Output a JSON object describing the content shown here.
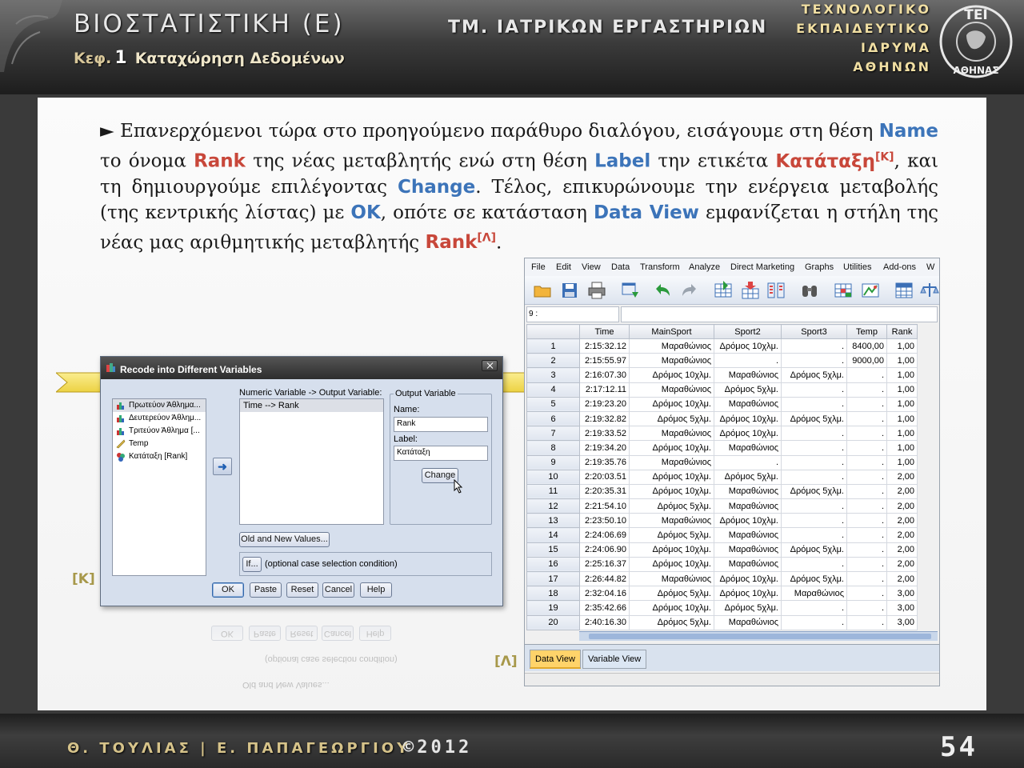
{
  "header": {
    "course_title": "ΒΙΟΣΤΑΤΙΣΤΙΚΗ (Ε)",
    "chapter_prefix": "Κεφ.",
    "chapter_number": "1",
    "chapter_title": "Καταχώρηση Δεδομένων",
    "department": "ΤΜ. ΙΑΤΡΙΚΩΝ ΕΡΓΑΣΤΗΡΙΩΝ",
    "institution_lines": [
      "ΤΕΧΝΟΛΟΓΙΚΟ",
      "ΕΚΠΑΙΔΕΥΤΙΚΟ",
      "ΙΔΡΥΜΑ",
      "ΑΘΗΝΩΝ"
    ],
    "logo_text": "ΤΕΙ ΑΘΗΝΑΣ"
  },
  "paragraph": {
    "bullet": "►",
    "t1": " Επανερχόμενοι τώρα στο προηγούμενο παράθυρο διαλόγου, εισάγουμε στη θέση ",
    "k1": "Name",
    "t2": " το όνομα ",
    "k2": "Rank",
    "t3": " της νέας μεταβλητής ενώ στη θέση ",
    "k3": "Label",
    "t4": " την ετικέτα ",
    "k4": "Κατάταξη",
    "ref_k": "[Κ]",
    "t5": ", και τη δημιουργούμε επιλέγοντας ",
    "k5": "Change",
    "t6": ". Τέλος, επικυρώνουμε την ενέργεια μεταβολής (της κεντρικής λίστας) με ",
    "k6": "OK",
    "t7": ", οπότε σε κατάσταση ",
    "k7": "Data View",
    "t8": " εμφανίζεται η στήλη της νέας μας αριθμητικής μεταβλητής ",
    "k8": "Rank",
    "ref_l": "[Λ]",
    "t9": "."
  },
  "dialog": {
    "title": "Recode into Different Variables",
    "variables": [
      "Πρωτεύον Άθλημα...",
      "Δευτερεύον Άθλημ...",
      "Τριτεύον Άθλημα [...",
      "Temp",
      "Κατάταξη [Rank]"
    ],
    "mapping_label": "Numeric Variable -> Output Variable:",
    "mapping_row": "Time --> Rank",
    "output_group": "Output Variable",
    "name_label": "Name:",
    "name_value": "Rank",
    "label_label": "Label:",
    "label_value": "Κατάταξη",
    "change": "Change",
    "old_new": "Old and New Values...",
    "if": "If...",
    "if_hint": "(optional case selection condition)",
    "ok": "OK",
    "paste": "Paste",
    "reset": "Reset",
    "cancel": "Cancel",
    "help": "Help"
  },
  "tags": {
    "k": "[Κ]",
    "l": "[Λ]"
  },
  "data_view": {
    "menu": [
      "File",
      "Edit",
      "View",
      "Data",
      "Transform",
      "Analyze",
      "Direct Marketing",
      "Graphs",
      "Utilities",
      "Add-ons",
      "W"
    ],
    "cell_ref": "9 :",
    "columns": [
      "",
      "Time",
      "MainSport",
      "Sport2",
      "Sport3",
      "Temp",
      "Rank"
    ],
    "rows": [
      [
        "1",
        "2:15:32.12",
        "Μαραθώνιος",
        "Δρόμος 10χλμ.",
        ".",
        "8400,00",
        "1,00"
      ],
      [
        "2",
        "2:15:55.97",
        "Μαραθώνιος",
        ".",
        ".",
        "9000,00",
        "1,00"
      ],
      [
        "3",
        "2:16:07.30",
        "Δρόμος 10χλμ.",
        "Μαραθώνιος",
        "Δρόμος 5χλμ.",
        ".",
        "1,00"
      ],
      [
        "4",
        "2:17:12.11",
        "Μαραθώνιος",
        "Δρόμος 5χλμ.",
        ".",
        ".",
        "1,00"
      ],
      [
        "5",
        "2:19:23.20",
        "Δρόμος 10χλμ.",
        "Μαραθώνιος",
        ".",
        ".",
        "1,00"
      ],
      [
        "6",
        "2:19:32.82",
        "Δρόμος 5χλμ.",
        "Δρόμος 10χλμ.",
        "Δρόμος 5χλμ.",
        ".",
        "1,00"
      ],
      [
        "7",
        "2:19:33.52",
        "Μαραθώνιος",
        "Δρόμος 10χλμ.",
        ".",
        ".",
        "1,00"
      ],
      [
        "8",
        "2:19:34.20",
        "Δρόμος 10χλμ.",
        "Μαραθώνιος",
        ".",
        ".",
        "1,00"
      ],
      [
        "9",
        "2:19:35.76",
        "Μαραθώνιος",
        ".",
        ".",
        ".",
        "1,00"
      ],
      [
        "10",
        "2:20:03.51",
        "Δρόμος 10χλμ.",
        "Δρόμος 5χλμ.",
        ".",
        ".",
        "2,00"
      ],
      [
        "11",
        "2:20:35.31",
        "Δρόμος 10χλμ.",
        "Μαραθώνιος",
        "Δρόμος 5χλμ.",
        ".",
        "2,00"
      ],
      [
        "12",
        "2:21:54.10",
        "Δρόμος 5χλμ.",
        "Μαραθώνιος",
        ".",
        ".",
        "2,00"
      ],
      [
        "13",
        "2:23:50.10",
        "Μαραθώνιος",
        "Δρόμος 10χλμ.",
        ".",
        ".",
        "2,00"
      ],
      [
        "14",
        "2:24:06.69",
        "Δρόμος 5χλμ.",
        "Μαραθώνιος",
        ".",
        ".",
        "2,00"
      ],
      [
        "15",
        "2:24:06.90",
        "Δρόμος 10χλμ.",
        "Μαραθώνιος",
        "Δρόμος 5χλμ.",
        ".",
        "2,00"
      ],
      [
        "16",
        "2:25:16.37",
        "Δρόμος 10χλμ.",
        "Μαραθώνιος",
        ".",
        ".",
        "2,00"
      ],
      [
        "17",
        "2:26:44.82",
        "Μαραθώνιος",
        "Δρόμος 10χλμ.",
        "Δρόμος 5χλμ.",
        ".",
        "2,00"
      ],
      [
        "18",
        "2:32:04.16",
        "Δρόμος 5χλμ.",
        "Δρόμος 10χλμ.",
        "Μαραθώνιος",
        ".",
        "3,00"
      ],
      [
        "19",
        "2:35:42.66",
        "Δρόμος 10χλμ.",
        "Δρόμος 5χλμ.",
        ".",
        ".",
        "3,00"
      ],
      [
        "20",
        "2:40:16.30",
        "Δρόμος 5χλμ.",
        "Μαραθώνιος",
        ".",
        ".",
        "3,00"
      ]
    ],
    "tabs": [
      "Data View",
      "Variable View"
    ]
  },
  "footer": {
    "authors": "Θ. ΤΟΥΛΙΑΣ | Ε. ΠΑΠΑΓΕΩΡΓΙΟΥ",
    "copyright": "©2012",
    "page": "54"
  }
}
